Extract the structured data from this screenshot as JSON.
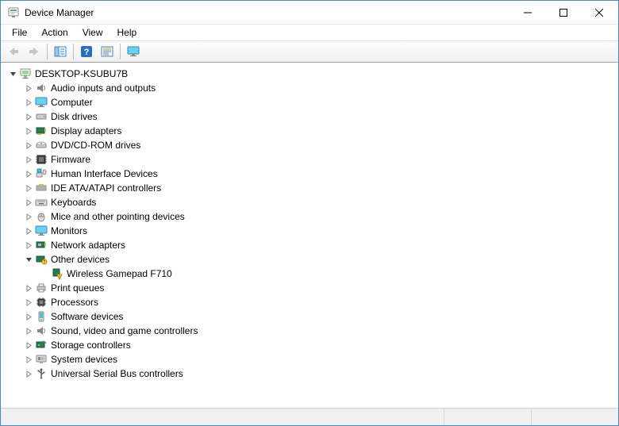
{
  "window": {
    "title": "Device Manager"
  },
  "menu": {
    "file": "File",
    "action": "Action",
    "view": "View",
    "help": "Help"
  },
  "tree": {
    "root": "DESKTOP-KSUBU7B",
    "audio": "Audio inputs and outputs",
    "computer": "Computer",
    "disk": "Disk drives",
    "display": "Display adapters",
    "dvd": "DVD/CD-ROM drives",
    "firmware": "Firmware",
    "hid": "Human Interface Devices",
    "ide": "IDE ATA/ATAPI controllers",
    "keyboards": "Keyboards",
    "mice": "Mice and other pointing devices",
    "monitors": "Monitors",
    "network": "Network adapters",
    "other": "Other devices",
    "other_child": "Wireless Gamepad F710",
    "printqueues": "Print queues",
    "processors": "Processors",
    "software": "Software devices",
    "sound": "Sound, video and game controllers",
    "storage": "Storage controllers",
    "system": "System devices",
    "usb": "Universal Serial Bus controllers"
  }
}
